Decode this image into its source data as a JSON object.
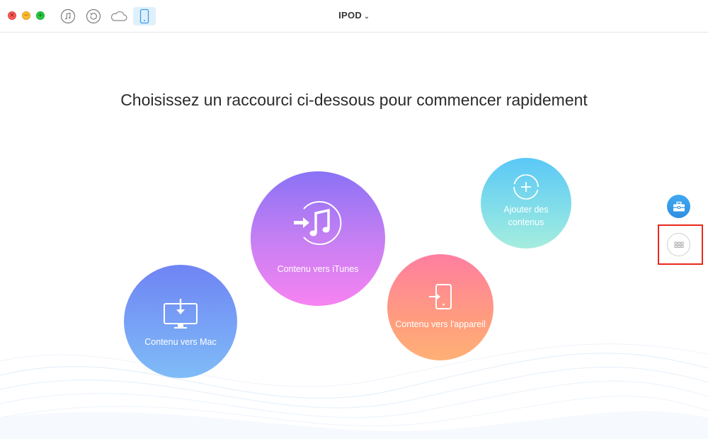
{
  "window": {
    "device_name": "IPOD",
    "device_dropdown_icon": "chevron-down-icon"
  },
  "toolbar": {
    "icons": [
      "music-note-icon",
      "restore-icon",
      "cloud-icon",
      "phone-icon"
    ],
    "active_icon": "phone-icon"
  },
  "main": {
    "headline": "Choisissez un raccourci ci-dessous pour commencer rapidement",
    "shortcuts": {
      "mac": {
        "label": "Contenu vers Mac",
        "icon": "monitor-download-icon"
      },
      "itunes": {
        "label": "Contenu vers iTunes",
        "icon": "itunes-transfer-icon"
      },
      "device": {
        "label": "Contenu vers l'appareil",
        "icon": "device-transfer-icon"
      },
      "add": {
        "label_line1": "Ajouter des",
        "label_line2": "contenus",
        "icon": "add-circle-icon"
      }
    }
  },
  "side": {
    "toolbox_icon": "toolbox-icon",
    "more_icon": "grid-dots-icon"
  },
  "colors": {
    "highlight": "#e8291c",
    "accent": "#3a9ced"
  }
}
